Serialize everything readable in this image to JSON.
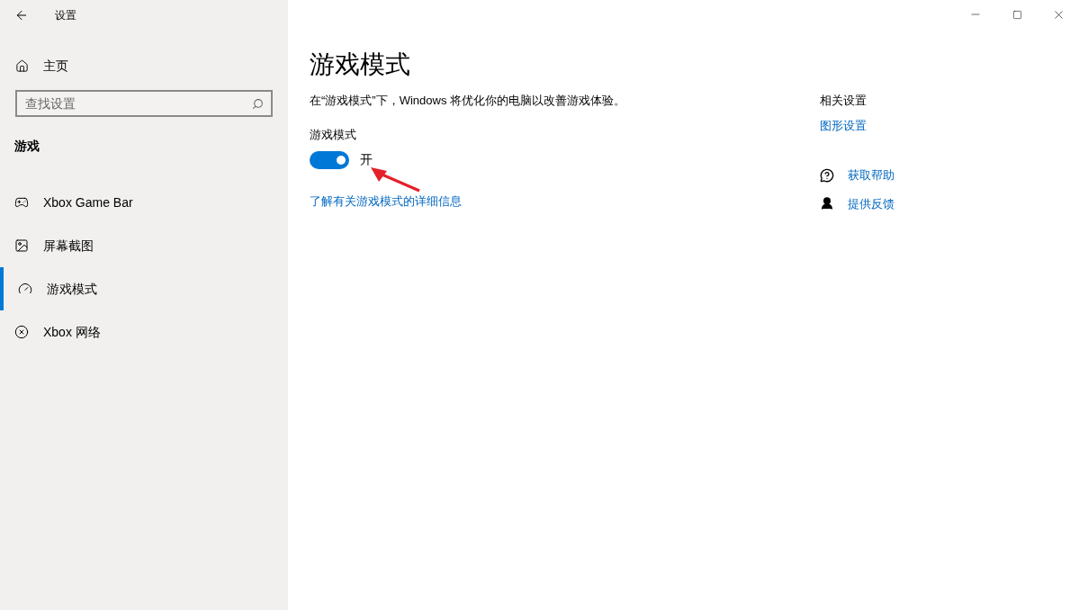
{
  "window": {
    "title": "设置"
  },
  "sidebar": {
    "home": "主页",
    "search": {
      "placeholder": "查找设置"
    },
    "section": "游戏",
    "items": [
      {
        "kind": "gamebar",
        "label": "Xbox Game Bar",
        "selected": false
      },
      {
        "kind": "screenshot",
        "label": "屏幕截图",
        "selected": false
      },
      {
        "kind": "gauge",
        "label": "游戏模式",
        "selected": true
      },
      {
        "kind": "xbox",
        "label": "Xbox 网络",
        "selected": false
      }
    ]
  },
  "main": {
    "title": "游戏模式",
    "description": "在“游戏模式”下，Windows 将优化你的电脑以改善游戏体验。",
    "setting": {
      "label": "游戏模式",
      "on": true,
      "state_text": "开"
    },
    "link": "了解有关游戏模式的详细信息"
  },
  "related": {
    "heading": "相关设置",
    "link": "图形设置",
    "help": [
      {
        "kind": "help",
        "label": "获取帮助"
      },
      {
        "kind": "feedback",
        "label": "提供反馈"
      }
    ]
  }
}
